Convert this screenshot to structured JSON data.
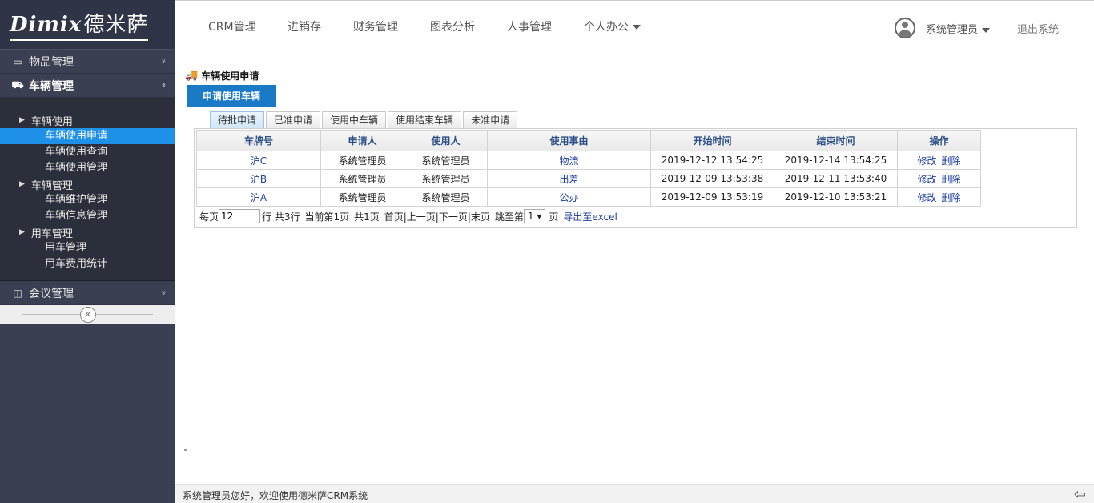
{
  "logo": {
    "latin": "Dimix",
    "cn": "德米萨"
  },
  "topnav": {
    "items": [
      "CRM管理",
      "进销存",
      "财务管理",
      "图表分析",
      "人事管理",
      "个人办公"
    ],
    "user": "系统管理员",
    "logout": "退出系统"
  },
  "sidebar": {
    "groups": [
      {
        "label": "物品管理",
        "icon": "inbox-icon",
        "glyph": "▭",
        "chevron": "»"
      },
      {
        "label": "车辆管理",
        "icon": "truck-icon",
        "glyph": "⛟",
        "chevron": "«"
      },
      {
        "label": "会议管理",
        "icon": "columns-icon",
        "glyph": "◫",
        "chevron": "»"
      }
    ],
    "sub": [
      {
        "label": "车辆使用",
        "items": [
          "车辆使用申请",
          "车辆使用查询",
          "车辆使用管理"
        ]
      },
      {
        "label": "车辆管理",
        "items": [
          "车辆维护管理",
          "车辆信息管理"
        ]
      },
      {
        "label": "用车管理",
        "items": [
          "用车管理",
          "用车费用统计"
        ]
      }
    ],
    "collapse": "«"
  },
  "page": {
    "crumb": "车辆使用申请",
    "apply_button": "申请使用车辆",
    "tabs": [
      "待批申请",
      "已准申请",
      "使用中车辆",
      "使用结束车辆",
      "未准申请"
    ]
  },
  "table": {
    "headers": [
      "车牌号",
      "申请人",
      "使用人",
      "使用事由",
      "开始时间",
      "结束时间",
      "操作"
    ],
    "rows": [
      {
        "plate": "沪C",
        "applicant": "系统管理员",
        "user": "系统管理员",
        "reason": "物流",
        "start": "2019-12-12 13:54:25",
        "end": "2019-12-14 13:54:25",
        "edit": "修改",
        "del": "删除"
      },
      {
        "plate": "沪B",
        "applicant": "系统管理员",
        "user": "系统管理员",
        "reason": "出差",
        "start": "2019-12-09 13:53:38",
        "end": "2019-12-11 13:53:40",
        "edit": "修改",
        "del": "删除"
      },
      {
        "plate": "沪A",
        "applicant": "系统管理员",
        "user": "系统管理员",
        "reason": "公办",
        "start": "2019-12-09 13:53:19",
        "end": "2019-12-10 13:53:21",
        "edit": "修改",
        "del": "删除"
      }
    ]
  },
  "pager": {
    "per_page_label": "每页",
    "per_page_value": "12",
    "rows_text": "行 共3行",
    "current_text": "当前第1页",
    "total_text": "共1页",
    "nav_text": "首页|上一页|下一页|末页",
    "jump_label": "跳至第",
    "jump_value": "1 ▾",
    "page_unit": "页",
    "export": "导出至excel"
  },
  "footer": {
    "message": "系统管理员您好，欢迎使用德米萨CRM系统"
  }
}
